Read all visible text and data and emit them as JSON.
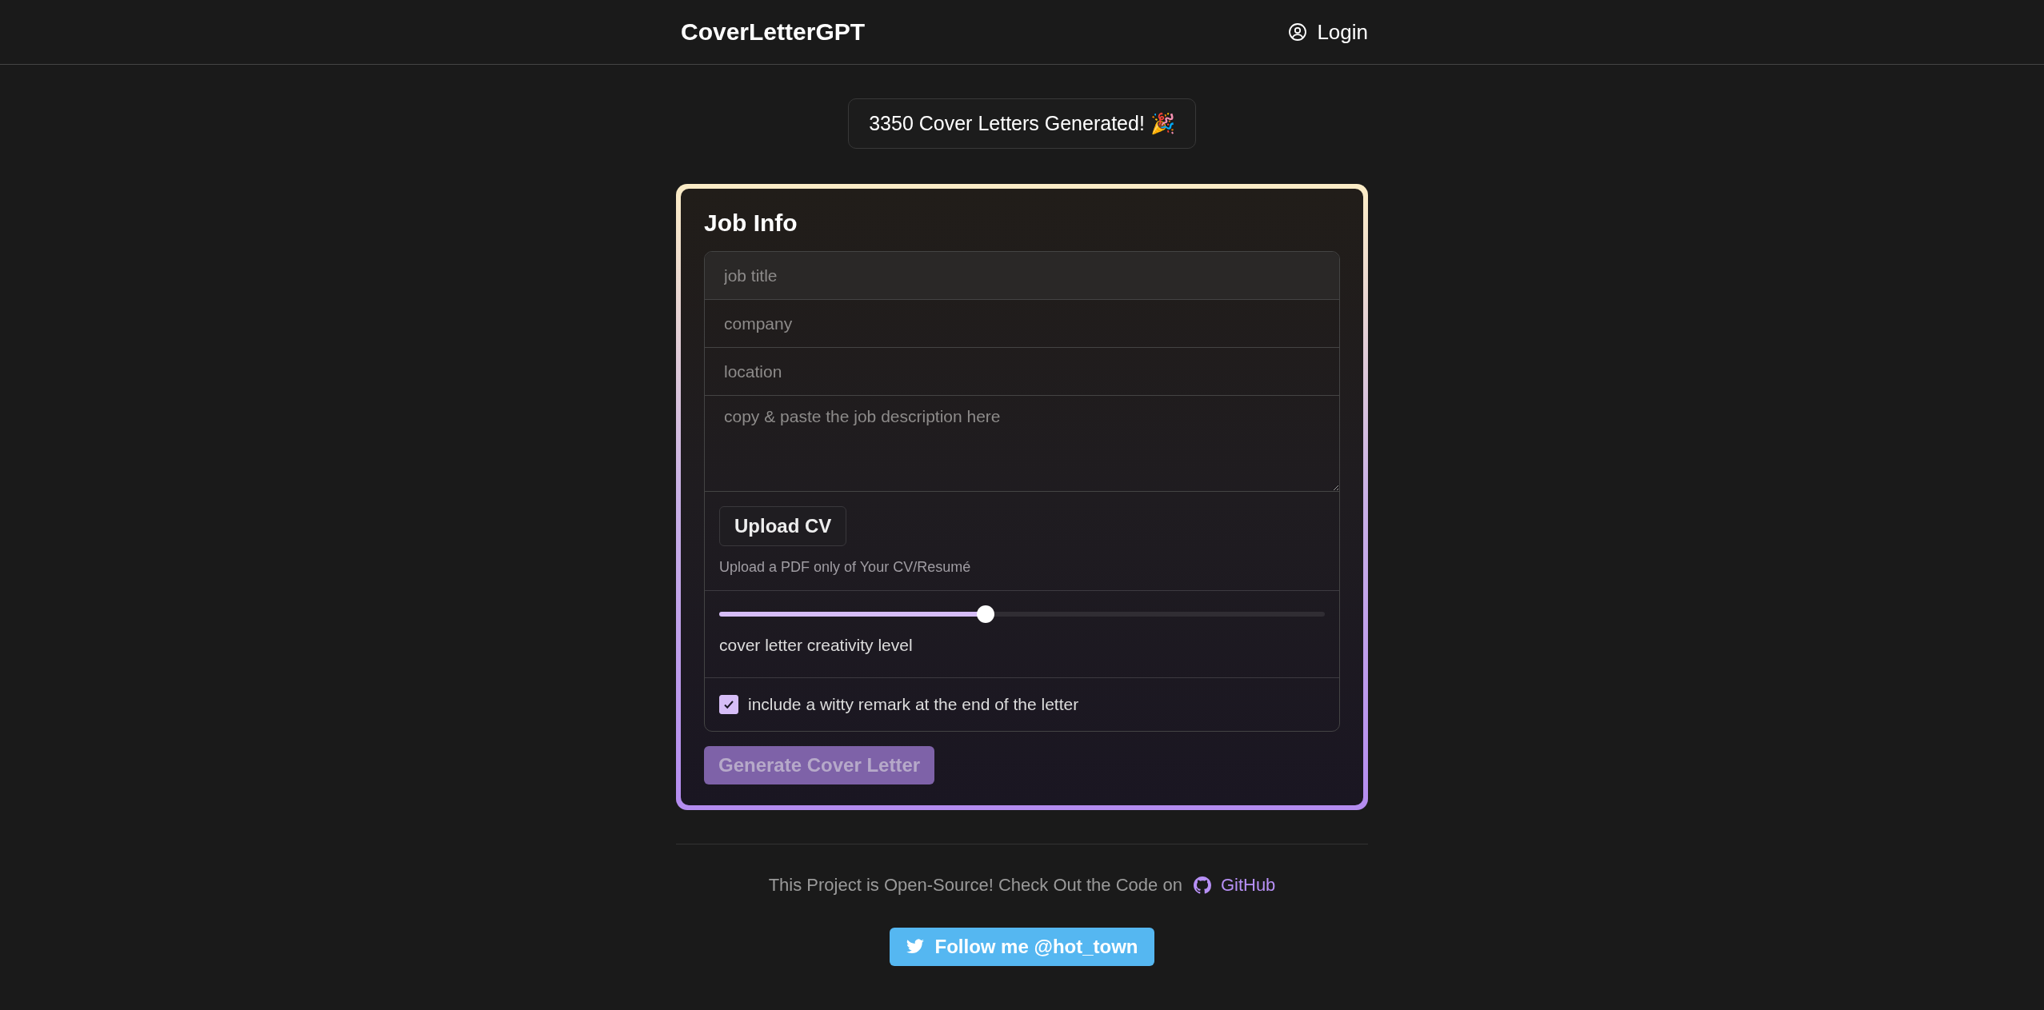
{
  "header": {
    "logo": "CoverLetterGPT",
    "login": "Login"
  },
  "counter": "3350 Cover Letters Generated! 🎉",
  "form": {
    "title": "Job Info",
    "fields": [
      {
        "placeholder": "job title"
      },
      {
        "placeholder": "company"
      },
      {
        "placeholder": "location"
      }
    ],
    "description": {
      "placeholder": "copy & paste the job description here"
    },
    "upload": {
      "button": "Upload CV",
      "hint": "Upload a PDF only of Your CV/Resumé"
    },
    "creativity": {
      "level": 0.44,
      "label": "cover letter creativity level"
    },
    "witty": {
      "checked": true,
      "label": "include a witty remark at the end of the letter"
    },
    "submit": {
      "label": "Generate Cover Letter",
      "disabled": true
    }
  },
  "footer": {
    "text": "This Project is Open-Source! Check Out the Code on",
    "link": "GitHub",
    "twitter": "Follow me @hot_town"
  }
}
